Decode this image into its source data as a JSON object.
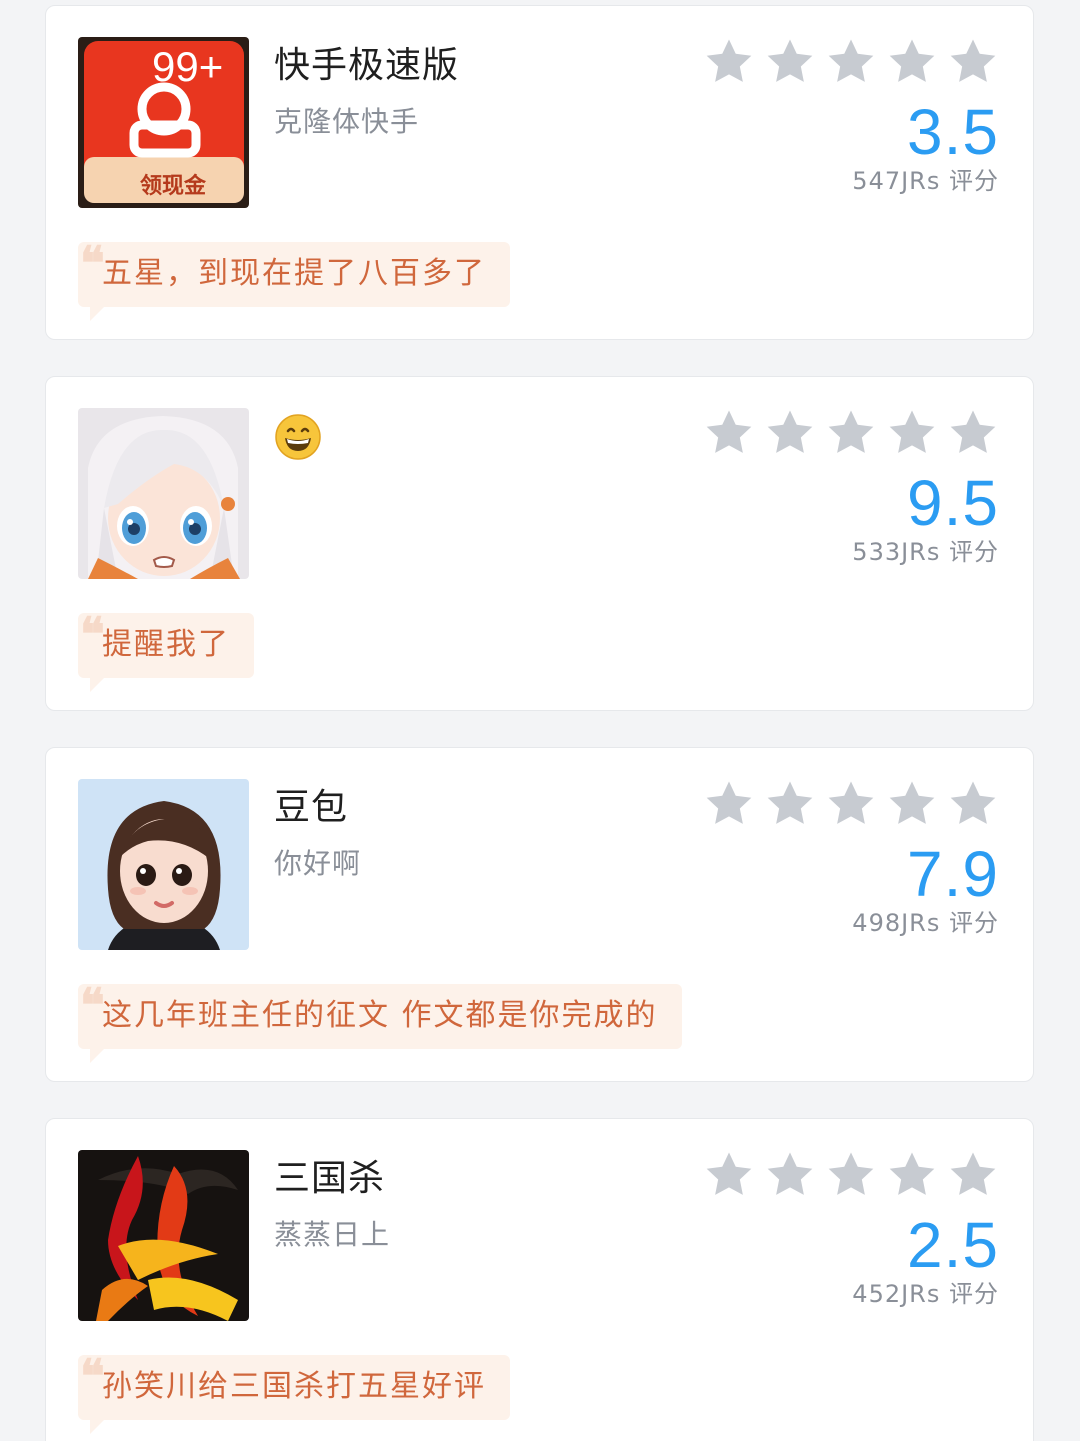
{
  "reviews": [
    {
      "name": "快手极速版",
      "subtitle": "克隆体快手",
      "avatar_icon": "kuaishou-speed-app-icon",
      "avatar_badge": "99+",
      "avatar_badge_caption": "领现金",
      "rating_stars": 5,
      "score": "3.5",
      "votes": "547JRs 评分",
      "comment": "五星，到现在提了八百多了"
    },
    {
      "name": "",
      "name_icon": "grinning-face-emoji-icon",
      "subtitle": "",
      "avatar_icon": "anime-girl-avatar",
      "rating_stars": 5,
      "score": "9.5",
      "votes": "533JRs 评分",
      "comment": "提醒我了"
    },
    {
      "name": "豆包",
      "subtitle": "你好啊",
      "avatar_icon": "doubao-3d-girl-avatar",
      "rating_stars": 5,
      "score": "7.9",
      "votes": "498JRs 评分",
      "comment": "这几年班主任的征文 作文都是你完成的"
    },
    {
      "name": "三国杀",
      "subtitle": "蒸蒸日上",
      "avatar_icon": "sanguosha-sha-character-icon",
      "rating_stars": 5,
      "score": "2.5",
      "votes": "452JRs 评分",
      "comment": "孙笑川给三国杀打五星好评"
    }
  ],
  "colors": {
    "score": "#2b9cf2",
    "star": "#c7cbd1",
    "comment_text": "#d0673c",
    "comment_bg": "#fdf2ea",
    "card_bg": "#ffffff",
    "page_bg": "#f3f4f6"
  }
}
